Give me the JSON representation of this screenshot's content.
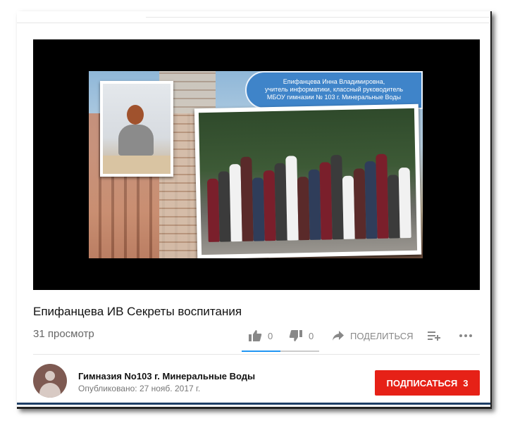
{
  "video": {
    "title": "Епифанцева ИВ Секреты воспитания",
    "views": "31 просмотр",
    "likes": "0",
    "dislikes": "0",
    "like_ratio": 0.5,
    "share_label": "ПОДЕЛИТЬСЯ"
  },
  "slide": {
    "caption_line1": "Епифанцева Инна Владимировна,",
    "caption_line2": "учитель информатики, классный руководитель",
    "caption_line3": "МБОУ гимназии № 103 г. Минеральные Воды"
  },
  "channel": {
    "name": "Гимназия No103 г. Минеральные Воды",
    "published": "Опубликовано: 27 нояб. 2017 г.",
    "subscribe_label": "ПОДПИСАТЬСЯ",
    "subscriber_count": "3"
  },
  "icons": [
    "thumb-up-icon",
    "thumb-down-icon",
    "share-icon",
    "add-to-playlist-icon",
    "more-icon"
  ],
  "colors": {
    "subscribe": "#e62117",
    "like_bar": "#2196f3",
    "caption_bg": "#3f84c9"
  }
}
